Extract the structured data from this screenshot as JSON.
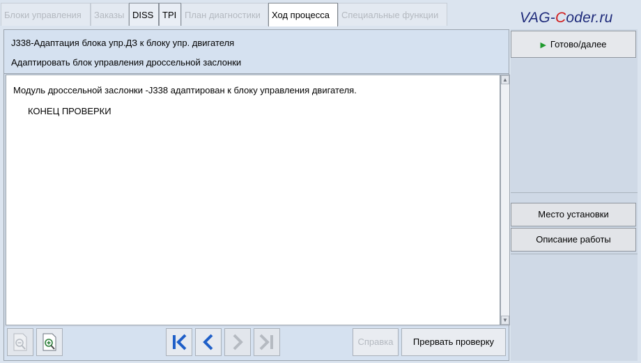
{
  "tabs": [
    {
      "label": "Блоки управления",
      "state": "disabled"
    },
    {
      "label": "Заказы",
      "state": "disabled"
    },
    {
      "label": "DISS",
      "state": "enabled"
    },
    {
      "label": "TPI",
      "state": "enabled"
    },
    {
      "label": "План диагностики",
      "state": "disabled"
    },
    {
      "label": "Ход процесса",
      "state": "active"
    },
    {
      "label": "Специальные функции",
      "state": "disabled"
    }
  ],
  "logo": {
    "part1": "VAG-",
    "part2": "C",
    "part3": "oder.ru"
  },
  "header": {
    "line1": "J338-Адаптация блока упр.ДЗ к блоку упр. двигателя",
    "line2": "Адаптировать блок управления дроссельной заслонки"
  },
  "content": {
    "message": "Модуль дроссельной заслонки -J338 адаптирован к блоку управления двигателя.",
    "end_text": "КОНЕЦ ПРОВЕРКИ"
  },
  "bottom": {
    "help_label": "Справка",
    "abort_label": "Прервать проверку"
  },
  "side": {
    "next_label": "Готово/далее",
    "location_label": "Место установки",
    "description_label": "Описание работы"
  },
  "colors": {
    "accent_blue": "#1f5fc8",
    "play_green": "#1e9a2d",
    "logo_red": "#d11a1a",
    "logo_blue": "#1e2a7a"
  }
}
